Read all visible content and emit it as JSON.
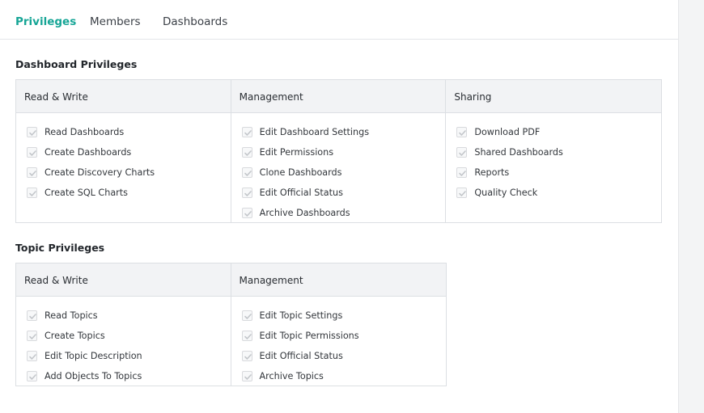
{
  "tabs": [
    {
      "label": "Privileges",
      "active": true
    },
    {
      "label": "Members",
      "active": false
    },
    {
      "label": "Dashboards",
      "active": false
    }
  ],
  "accent_color": "#16a596",
  "checkbox_state": "checked-disabled",
  "sections": [
    {
      "title": "Dashboard Privileges",
      "columns": [
        {
          "header": "Read & Write",
          "items": [
            "Read Dashboards",
            "Create Dashboards",
            "Create Discovery Charts",
            "Create SQL Charts"
          ]
        },
        {
          "header": "Management",
          "items": [
            "Edit Dashboard Settings",
            "Edit Permissions",
            "Clone Dashboards",
            "Edit Official Status",
            "Archive Dashboards"
          ]
        },
        {
          "header": "Sharing",
          "items": [
            "Download PDF",
            "Shared Dashboards",
            "Reports",
            "Quality Check"
          ]
        }
      ]
    },
    {
      "title": "Topic Privileges",
      "columns": [
        {
          "header": "Read & Write",
          "items": [
            "Read Topics",
            "Create Topics",
            "Edit Topic Description",
            "Add Objects To Topics"
          ]
        },
        {
          "header": "Management",
          "items": [
            "Edit Topic Settings",
            "Edit Topic Permissions",
            "Edit Official Status",
            "Archive Topics"
          ]
        }
      ]
    }
  ]
}
